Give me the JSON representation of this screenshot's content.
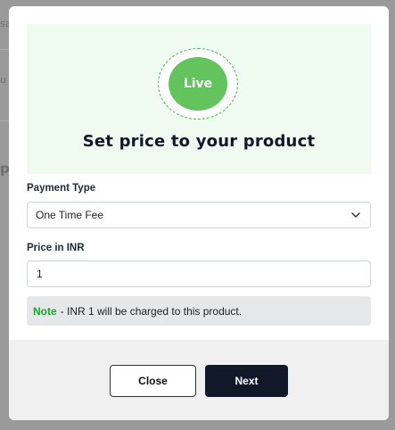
{
  "background": {
    "fragments": [
      "sa",
      "u",
      "p"
    ]
  },
  "hero": {
    "badge": "Live",
    "title": "Set price to your product"
  },
  "payment_type": {
    "label": "Payment Type",
    "selected": "One Time Fee"
  },
  "price": {
    "label": "Price in INR",
    "value": "1"
  },
  "note": {
    "label": "Note",
    "text": "- INR 1 will be charged to this product."
  },
  "footer": {
    "close_label": "Close",
    "next_label": "Next"
  },
  "colors": {
    "accent_green": "#63c35c",
    "note_green": "#17a52e",
    "primary_dark": "#111827"
  },
  "icons": {
    "dropdown": "chevron-down-icon"
  }
}
